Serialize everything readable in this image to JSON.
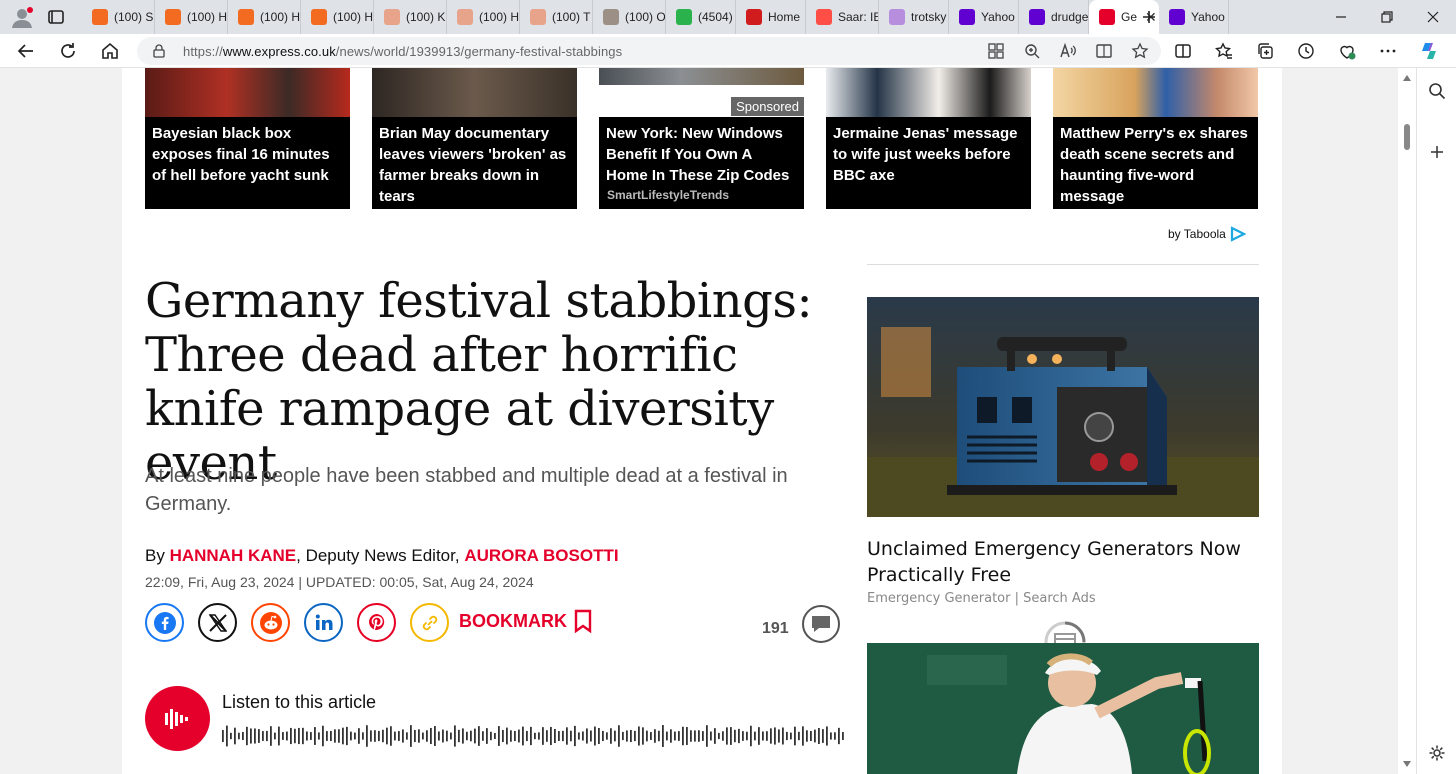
{
  "browser": {
    "tabs": [
      {
        "label": "(100) S",
        "favicon": "blogger-icon",
        "color": "#f26b21"
      },
      {
        "label": "(100) H",
        "favicon": "blogger-icon",
        "color": "#f26b21"
      },
      {
        "label": "(100) H",
        "favicon": "blogger-icon",
        "color": "#f26b21"
      },
      {
        "label": "(100) H",
        "favicon": "blogger-icon",
        "color": "#f26b21"
      },
      {
        "label": "(100) K",
        "favicon": "blogger-icon",
        "color": "#e8a48a"
      },
      {
        "label": "(100) H",
        "favicon": "blogger-icon",
        "color": "#e8a48a"
      },
      {
        "label": "(100) T",
        "favicon": "blogger-icon",
        "color": "#e8a48a"
      },
      {
        "label": "(100) O",
        "favicon": "picture-icon",
        "color": "#9b8f86"
      },
      {
        "label": "(4504)",
        "favicon": "g-icon",
        "color": "#2ab24d"
      },
      {
        "label": "Home",
        "favicon": "home-icon",
        "color": "#d01c1c"
      },
      {
        "label": "Saar: IE",
        "favicon": "youtube-icon",
        "color": "#ff4e45"
      },
      {
        "label": "trotsky",
        "favicon": "yahoo-icon",
        "color": "#b68edd"
      },
      {
        "label": "Yahoo",
        "favicon": "yahoo-icon",
        "color": "#6001d2"
      },
      {
        "label": "drudge",
        "favicon": "yahoo-icon",
        "color": "#6001d2"
      },
      {
        "label": "Ge",
        "favicon": "express-icon",
        "color": "#e4002b",
        "active": true
      },
      {
        "label": "Yahoo",
        "favicon": "yahoo-icon",
        "color": "#6001d2"
      }
    ],
    "url_prefix": "https://",
    "url_domain": "www.express.co.uk",
    "url_path": "/news/world/1939913/germany-festival-stabbings"
  },
  "taboola": {
    "cards": [
      {
        "title": "Bayesian black box exposes final 16 minutes of hell before yacht sunk",
        "source": "",
        "sponsored": false
      },
      {
        "title": "Brian May documentary leaves viewers 'broken' as farmer breaks down in tears",
        "source": "",
        "sponsored": false
      },
      {
        "title": "New York: New Windows Benefit If You Own A Home In These Zip Codes",
        "source": "SmartLifestyleTrends",
        "sponsored": true,
        "sponsored_label": "Sponsored"
      },
      {
        "title": "Jermaine Jenas' message to wife just weeks before BBC axe",
        "source": "",
        "sponsored": false
      },
      {
        "title": "Matthew Perry's ex shares death scene secrets and haunting five-word message",
        "source": "",
        "sponsored": false
      }
    ],
    "attribution": "by Taboola"
  },
  "article": {
    "headline": "Germany festival stabbings: Three dead after horrific knife rampage at diversity event",
    "standfirst": "At least nine people have been stabbed and multiple dead at a festival in Germany.",
    "by_prefix": "By ",
    "author1": "HANNAH KANE",
    "author1_role": ", Deputy News Editor, ",
    "author2": "AURORA BOSOTTI",
    "dateline": "22:09, Fri, Aug 23, 2024 | UPDATED: 00:05, Sat, Aug 24, 2024",
    "bookmark_label": "BOOKMARK",
    "comment_count": "191",
    "listen_label": "Listen to this article"
  },
  "sidebar_ad": {
    "title": "Unclaimed Emergency Generators Now Practically Free",
    "source": "Emergency Generator | Search Ads"
  },
  "colors": {
    "brand_red": "#e4002b",
    "facebook": "#1877f2",
    "x": "#111111",
    "reddit": "#ff4500",
    "linkedin": "#0a66c2",
    "pinterest": "#e60023",
    "link": "#f5b800"
  }
}
